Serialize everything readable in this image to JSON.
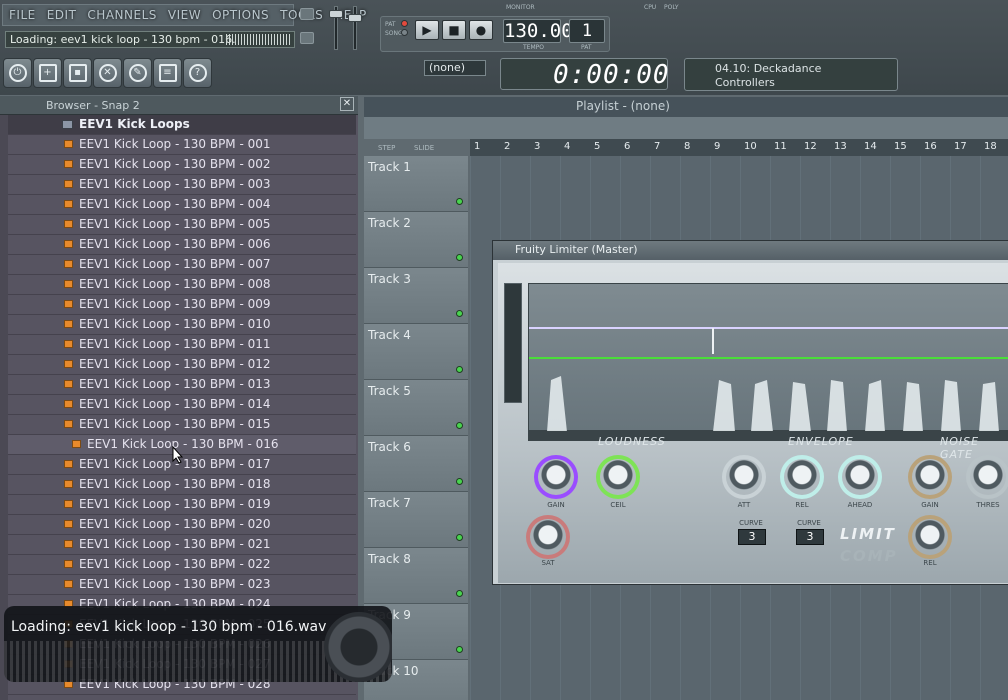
{
  "menu": [
    "FILE",
    "EDIT",
    "CHANNELS",
    "VIEW",
    "OPTIONS",
    "TOOLS",
    "HELP"
  ],
  "hint_bar": "Loading: eev1 kick loop - 130 bpm - 016.",
  "transport": {
    "tempo": "130.000",
    "tempo_label": "TEMPO",
    "pattern": "1",
    "pattern_label": "PAT",
    "pat_label": "PAT",
    "song_label": "SONG",
    "monitor_label": "MONITOR",
    "cpu_label": "CPU",
    "poly_label": "POLY"
  },
  "pattern_select": "(none)",
  "time_display": "0:00:00",
  "hint_panel": {
    "line1": "04.10: Deckadance",
    "line2": "Controllers"
  },
  "browser": {
    "title": "Browser - Snap 2",
    "folder": "EEV1 Kick Loops",
    "items": [
      "EEV1 Kick Loop - 130 BPM - 001",
      "EEV1 Kick Loop - 130 BPM - 002",
      "EEV1 Kick Loop - 130 BPM - 003",
      "EEV1 Kick Loop - 130 BPM - 004",
      "EEV1 Kick Loop - 130 BPM - 005",
      "EEV1 Kick Loop - 130 BPM - 006",
      "EEV1 Kick Loop - 130 BPM - 007",
      "EEV1 Kick Loop - 130 BPM - 008",
      "EEV1 Kick Loop - 130 BPM - 009",
      "EEV1 Kick Loop - 130 BPM - 010",
      "EEV1 Kick Loop - 130 BPM - 011",
      "EEV1 Kick Loop - 130 BPM - 012",
      "EEV1 Kick Loop - 130 BPM - 013",
      "EEV1 Kick Loop - 130 BPM - 014",
      "EEV1 Kick Loop - 130 BPM - 015",
      "EEV1 Kick Loop - 130 BPM - 016",
      "EEV1 Kick Loop - 130 BPM - 017",
      "EEV1 Kick Loop - 130 BPM - 018",
      "EEV1 Kick Loop - 130 BPM - 019",
      "EEV1 Kick Loop - 130 BPM - 020",
      "EEV1 Kick Loop - 130 BPM - 021",
      "EEV1 Kick Loop - 130 BPM - 022",
      "EEV1 Kick Loop - 130 BPM - 023",
      "EEV1 Kick Loop - 130 BPM - 024",
      "EEV1 Kick Loop - 130 BPM - 025",
      "EEV1 Kick Loop - 130 BPM - 026",
      "EEV1 Kick Loop - 130 BPM - 027",
      "EEV1 Kick Loop - 130 BPM - 028"
    ],
    "selected_index": 15
  },
  "playlist": {
    "title": "Playlist - (none)",
    "step_label": "STEP",
    "slide_label": "SLIDE",
    "ruler": [
      "1",
      "2",
      "3",
      "4",
      "5",
      "6",
      "7",
      "8",
      "9",
      "10",
      "11",
      "12",
      "13",
      "14",
      "15",
      "16",
      "17",
      "18"
    ],
    "tracks": [
      "Track 1",
      "Track 2",
      "Track 3",
      "Track 4",
      "Track 5",
      "Track 6",
      "Track 7",
      "Track 8",
      "Track 9",
      "Track 10"
    ]
  },
  "limiter": {
    "title": "Fruity Limiter (Master)",
    "sections": [
      "LOUDNESS",
      "ENVELOPE",
      "NOISE GATE"
    ],
    "knobs": [
      "GAIN",
      "CEIL",
      "ATT",
      "REL",
      "AHEAD",
      "GAIN",
      "THRES",
      "SAT",
      "REL"
    ],
    "curve_label": "CURVE",
    "curve_values": [
      "3",
      "3"
    ],
    "logo_limit": "LIMIT",
    "logo_comp": "COMP"
  },
  "toast": "Loading: eev1 kick loop - 130 bpm - 016.wav",
  "colors": {
    "accent_green": "#4ade3a",
    "knob_purple": "#9a4dff",
    "knob_green": "#7ee356",
    "folder_orange": "#e88a2c"
  }
}
